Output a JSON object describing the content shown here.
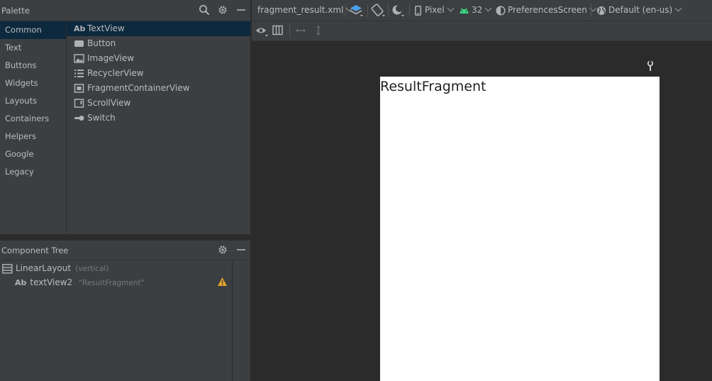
{
  "palette": {
    "title": "Palette",
    "categories": [
      "Common",
      "Text",
      "Buttons",
      "Widgets",
      "Layouts",
      "Containers",
      "Helpers",
      "Google",
      "Legacy"
    ],
    "selected_category": "Common",
    "items": [
      {
        "label": "TextView",
        "icon": "text-ab-icon"
      },
      {
        "label": "Button",
        "icon": "button-icon"
      },
      {
        "label": "ImageView",
        "icon": "image-icon"
      },
      {
        "label": "RecyclerView",
        "icon": "list-icon"
      },
      {
        "label": "FragmentContainerView",
        "icon": "fragment-icon"
      },
      {
        "label": "ScrollView",
        "icon": "scroll-icon"
      },
      {
        "label": "Switch",
        "icon": "switch-icon"
      }
    ],
    "selected_item": "TextView"
  },
  "component_tree": {
    "title": "Component Tree",
    "root": {
      "label": "LinearLayout",
      "hint": "(vertical)"
    },
    "child": {
      "label": "textView2",
      "hint": "\"ResultFragment\"",
      "ab": "Ab"
    }
  },
  "toolbar": {
    "file": "fragment_result.xml",
    "device": "Pixel",
    "api": "32",
    "theme": "PreferencesScreen",
    "locale": "Default (en-us)"
  },
  "preview": {
    "text": "ResultFragment"
  },
  "colors": {
    "selection": "#0d293e",
    "panel": "#3c3f41",
    "background": "#2b2b2b",
    "android_green": "#3ddc84",
    "warning": "#e6a42b",
    "layer_blue": "#4a9ee8"
  }
}
